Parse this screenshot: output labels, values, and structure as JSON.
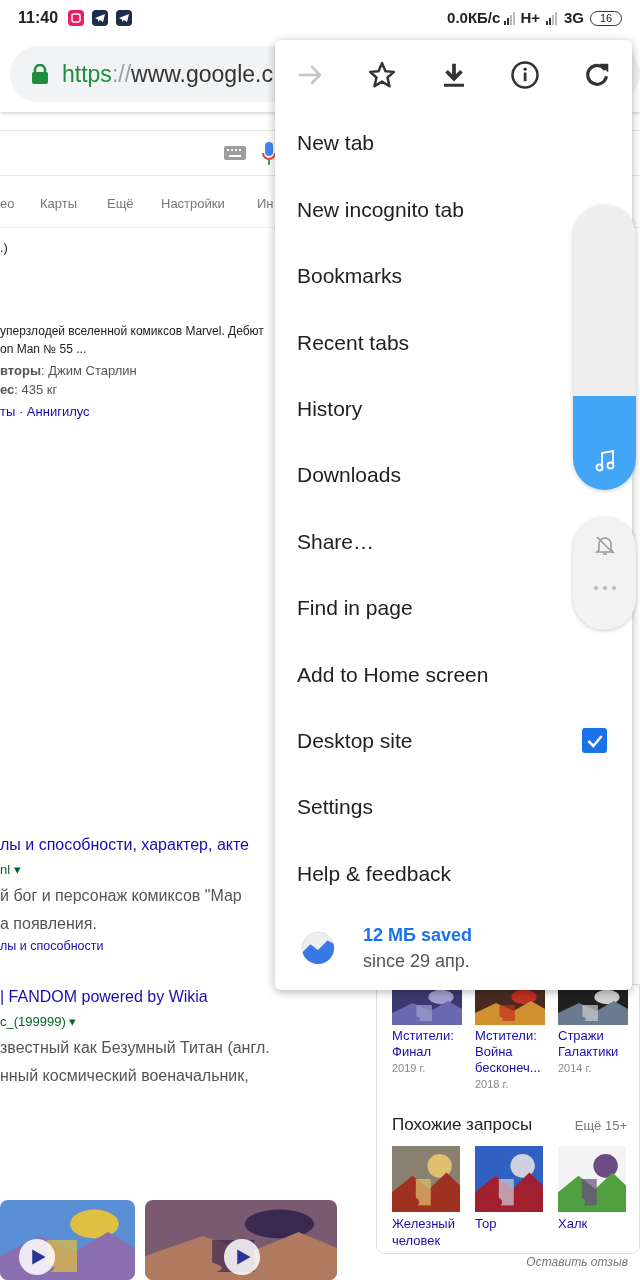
{
  "status_bar": {
    "time": "11:40",
    "speed": "0.0КБ/с",
    "network_1": "H+",
    "network_2": "3G",
    "battery": "16"
  },
  "url_bar": {
    "scheme": "https",
    "separator": "://",
    "host": "www.google.c"
  },
  "search_tabs": [
    "ео",
    "Карты",
    "Ещё",
    "Настройки",
    "Ин"
  ],
  "result_top": {
    "line_1": ".)",
    "snippet": [
      "уперзлодей вселенной комиксов Marvel. Дебют",
      "on Man № 55 ..."
    ],
    "facts": [
      "**вторы**: Джим Старлин",
      "**ес**: 435 кг"
    ],
    "links": "ты · Аннигилус"
  },
  "results": [
    {
      "title": "лы и способности, характер, акте",
      "url": "nl ▾",
      "snippet": [
        "й бог и персонаж комиксов \"Мар",
        "а появления."
      ],
      "sublink": "лы и способности"
    },
    {
      "title": "| FANDOM powered by Wikia",
      "url": "c_(199999) ▾",
      "snippet": [
        "звестный как Безумный Титан (англ.",
        "нный космический военачальник,"
      ]
    }
  ],
  "knowledge_panel": {
    "movies": [
      {
        "title": "Мстители: Финал",
        "year": "2019 г."
      },
      {
        "title": "Мстители: Война бесконеч...",
        "year": "2018 г."
      },
      {
        "title": "Стражи Галактики",
        "year": "2014 г."
      }
    ],
    "related_heading": "Похожие запросы",
    "related_more": "Ещё 15+",
    "related": [
      "Железный человек",
      "Тор",
      "Халк"
    ],
    "feedback": "Оставить отзыв"
  },
  "menu": {
    "icons": [
      {
        "kind": "forward",
        "disabled": true
      },
      {
        "kind": "star",
        "disabled": false
      },
      {
        "kind": "download",
        "disabled": false
      },
      {
        "kind": "info",
        "disabled": false
      },
      {
        "kind": "reload",
        "disabled": false
      }
    ],
    "items": [
      {
        "label": "New tab",
        "kind": "plain"
      },
      {
        "label": "New incognito tab",
        "kind": "plain"
      },
      {
        "label": "Bookmarks",
        "kind": "plain"
      },
      {
        "label": "Recent tabs",
        "kind": "plain"
      },
      {
        "label": "History",
        "kind": "plain"
      },
      {
        "label": "Downloads",
        "kind": "plain"
      },
      {
        "label": "Share…",
        "kind": "plain"
      },
      {
        "label": "Find in page",
        "kind": "plain"
      },
      {
        "label": "Add to Home screen",
        "kind": "plain"
      },
      {
        "label": "Desktop site",
        "kind": "checkbox",
        "checked": true
      },
      {
        "label": "Settings",
        "kind": "plain"
      },
      {
        "label": "Help & feedback",
        "kind": "plain"
      }
    ],
    "data_saver": {
      "amount": "12 МБ saved",
      "since": "since 29 апр."
    }
  },
  "volume": {
    "level": 0.33
  }
}
